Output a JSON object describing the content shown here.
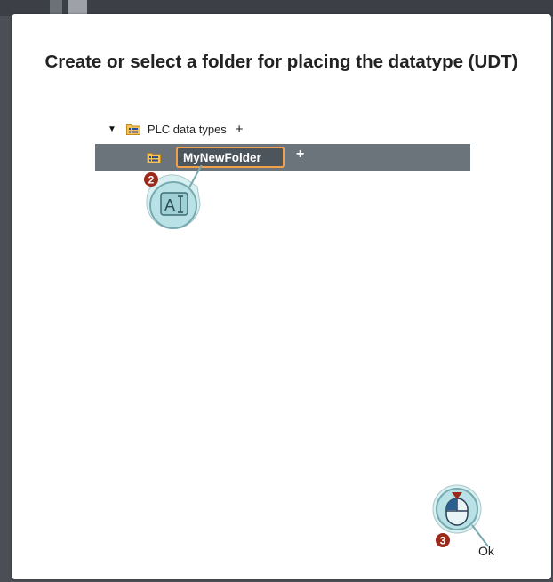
{
  "dialog": {
    "title": "Create or select a folder for placing the datatype (UDT)",
    "ok_label": "Ok"
  },
  "tree": {
    "root": {
      "label": "PLC data types",
      "expanded": true,
      "add_symbol": "+",
      "icon": "folder-icon"
    },
    "child": {
      "name_value": "MyNewFolder",
      "add_symbol": "+",
      "icon": "folder-icon"
    }
  },
  "callouts": [
    {
      "number": "2",
      "icon": "text-cursor-icon",
      "text": "A"
    },
    {
      "number": "3",
      "icon": "mouse-click-icon"
    }
  ],
  "colors": {
    "selection_row": "#6b737b",
    "input_border": "#f2a14a",
    "callout_fill": "#b9e2e6",
    "callout_badge": "#9b2a1a"
  }
}
